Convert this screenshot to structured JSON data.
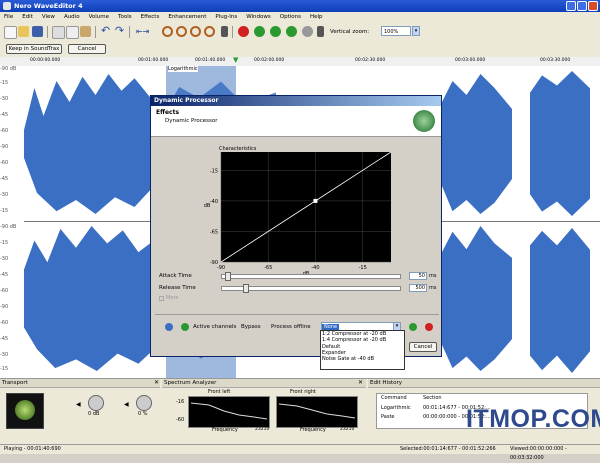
{
  "window": {
    "title": "Nero WaveEditor 4"
  },
  "menu": [
    "File",
    "Edit",
    "View",
    "Audio",
    "Volume",
    "Tools",
    "Effects",
    "Enhancement",
    "Plug-Ins",
    "Windows",
    "Options",
    "Help"
  ],
  "toolbar": {
    "vertical_zoom_label": "Vertical zoom:",
    "vertical_zoom_value": "100%"
  },
  "subbar": {
    "keep_button": "Keep in SoundTrax",
    "cancel_button": "Cancel"
  },
  "timeline": {
    "t0": "00:00:00.000",
    "t1": "00:01:00.000",
    "t2": "00:01:40.000",
    "t3": "00:02:00.000",
    "t4": "00:02:30.000",
    "t5": "00:03:00.000",
    "t6": "00:03:30.000",
    "selection_label": "Logarithmic"
  },
  "db_labels": [
    "-90 dB",
    "-15",
    "-30",
    "-45",
    "-60",
    "-90",
    "-60",
    "-45",
    "-30",
    "-15",
    "-90 dB",
    "-15",
    "-30",
    "-45",
    "-60",
    "-90",
    "-60",
    "-45",
    "-30",
    "-15"
  ],
  "dialog": {
    "title": "Dynamic Processor",
    "section": "Effects",
    "subtitle": "Dynamic Processor",
    "chart_title": "Characteristics",
    "attack_label": "Attack Time",
    "attack_value": "50",
    "attack_unit": "ms",
    "release_label": "Release Time",
    "release_value": "500",
    "release_unit": "ms",
    "more_label": "More",
    "active_channels": "Active channels",
    "bypass": "Bypass",
    "process_offline": "Process offline",
    "preset_selected": "None",
    "presets": [
      "1:2 Compressor at -20 dB",
      "1:4 Compressor at -20 dB",
      "Default",
      "Expander",
      "Noise Gate at -40 dB"
    ],
    "cancel": "Cancel"
  },
  "chart_data": {
    "type": "line",
    "title": "Characteristics",
    "xlabel": "dB",
    "ylabel": "dB",
    "x_ticks": [
      "-90",
      "-65",
      "-40",
      "-15"
    ],
    "y_ticks": [
      "-15",
      "-40",
      "-65",
      "-90"
    ],
    "xlim": [
      -90,
      0
    ],
    "ylim": [
      -90,
      0
    ],
    "grid": true,
    "series": [
      {
        "x": [
          -90,
          -40,
          0
        ],
        "y": [
          -90,
          -40,
          0
        ]
      }
    ],
    "control_points": [
      {
        "x": -40,
        "y": -40
      }
    ]
  },
  "panels": {
    "transport": "Transport",
    "spectrum": "Spectrum Analyzer",
    "edit_history": "Edit History",
    "knob1_value": "0 dB",
    "knob2_value": "0 %",
    "front_left": "Front left",
    "front_right": "Front right",
    "frequency": "Frequency",
    "freq_max": "23210",
    "db_top": "-16",
    "db_bot": "-60",
    "history_cols": [
      "Command",
      "Section"
    ],
    "history_rows": [
      {
        "cmd": "Logarithmic",
        "sec": "00:01:14:677 - 00:01:52:..."
      },
      {
        "cmd": "Paste",
        "sec": "00:00:00:000 - 00:01:52:..."
      }
    ]
  },
  "status": {
    "left": "Playing - 00:01:40:690",
    "mid": "Selected:00:01:14:677 - 00:01:52:266",
    "right": "Viewed:00:00:00:000 - 00:03:32:000"
  },
  "watermark": "ITMOP.COM",
  "colors": {
    "title": "#0d3fb8",
    "wave": "#3a6fc4",
    "chart_bg": "#000000"
  }
}
